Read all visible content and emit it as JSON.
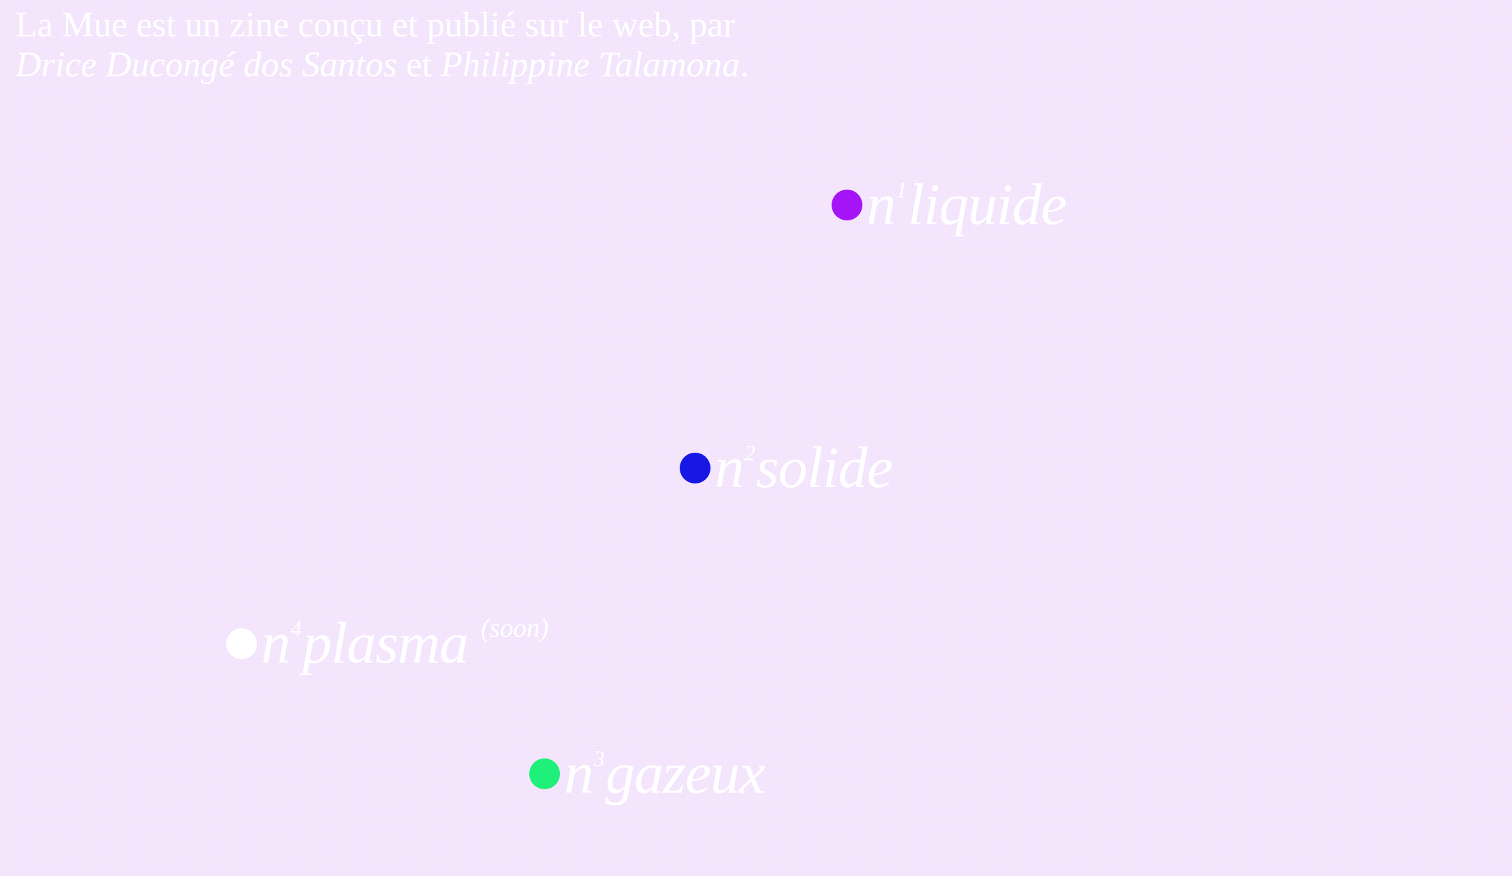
{
  "intro": {
    "line1": "La Mue est un zine conçu et publié sur le web, par",
    "author1": "Drice Ducongé dos Santos",
    "connector": "et",
    "author2": "Philippine Talamona",
    "end": "."
  },
  "issues": {
    "liquide": {
      "prefix": "n",
      "number": "1",
      "name": "liquide",
      "color": "#a414f6"
    },
    "solide": {
      "prefix": "n",
      "number": "2",
      "name": "solide",
      "color": "#1717e6"
    },
    "gazeux": {
      "prefix": "n",
      "number": "3",
      "name": "gazeux",
      "color": "#1ff07a"
    },
    "plasma": {
      "prefix": "n",
      "number": "4",
      "name": "plasma",
      "color": "#ffffff",
      "note": "(soon)"
    }
  },
  "colors": {
    "background": "#f3e4fc",
    "text": "#ffffff"
  }
}
